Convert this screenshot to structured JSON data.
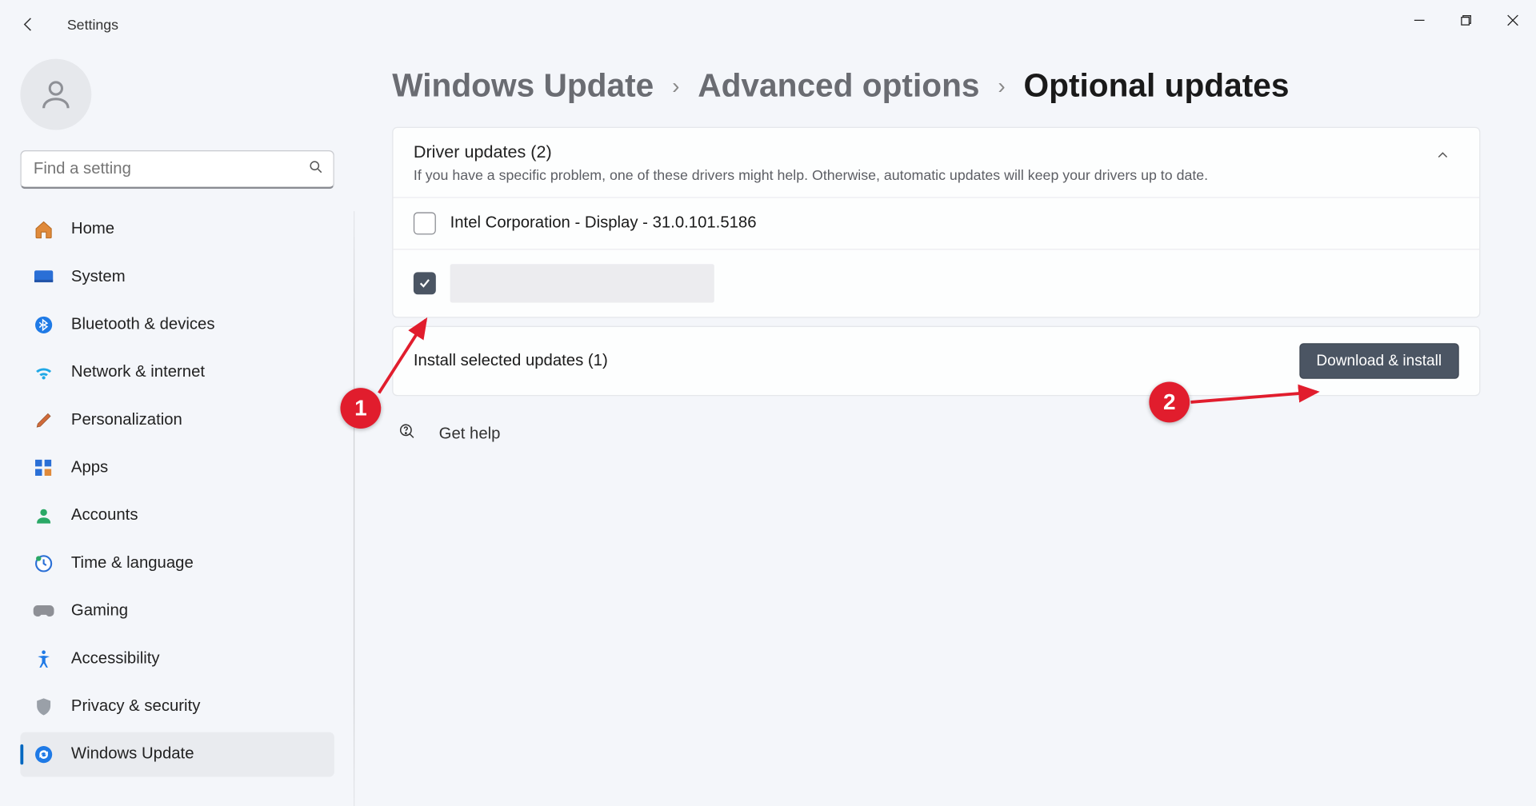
{
  "window": {
    "app_title": "Settings"
  },
  "search": {
    "placeholder": "Find a setting"
  },
  "sidebar": {
    "items": [
      {
        "label": "Home"
      },
      {
        "label": "System"
      },
      {
        "label": "Bluetooth & devices"
      },
      {
        "label": "Network & internet"
      },
      {
        "label": "Personalization"
      },
      {
        "label": "Apps"
      },
      {
        "label": "Accounts"
      },
      {
        "label": "Time & language"
      },
      {
        "label": "Gaming"
      },
      {
        "label": "Accessibility"
      },
      {
        "label": "Privacy & security"
      },
      {
        "label": "Windows Update"
      }
    ],
    "active_index": 11
  },
  "breadcrumb": {
    "a": "Windows Update",
    "b": "Advanced options",
    "c": "Optional updates"
  },
  "driver_section": {
    "title": "Driver updates (2)",
    "desc": "If you have a specific problem, one of these drivers might help. Otherwise, automatic updates will keep your drivers up to date.",
    "updates": [
      {
        "label": "Intel Corporation - Display - 31.0.101.5186",
        "checked": false,
        "redacted": false
      },
      {
        "label": "",
        "checked": true,
        "redacted": true
      }
    ]
  },
  "install": {
    "text": "Install selected updates (1)",
    "button": "Download & install"
  },
  "help": {
    "label": "Get help"
  },
  "annotations": {
    "a1": "1",
    "a2": "2"
  }
}
